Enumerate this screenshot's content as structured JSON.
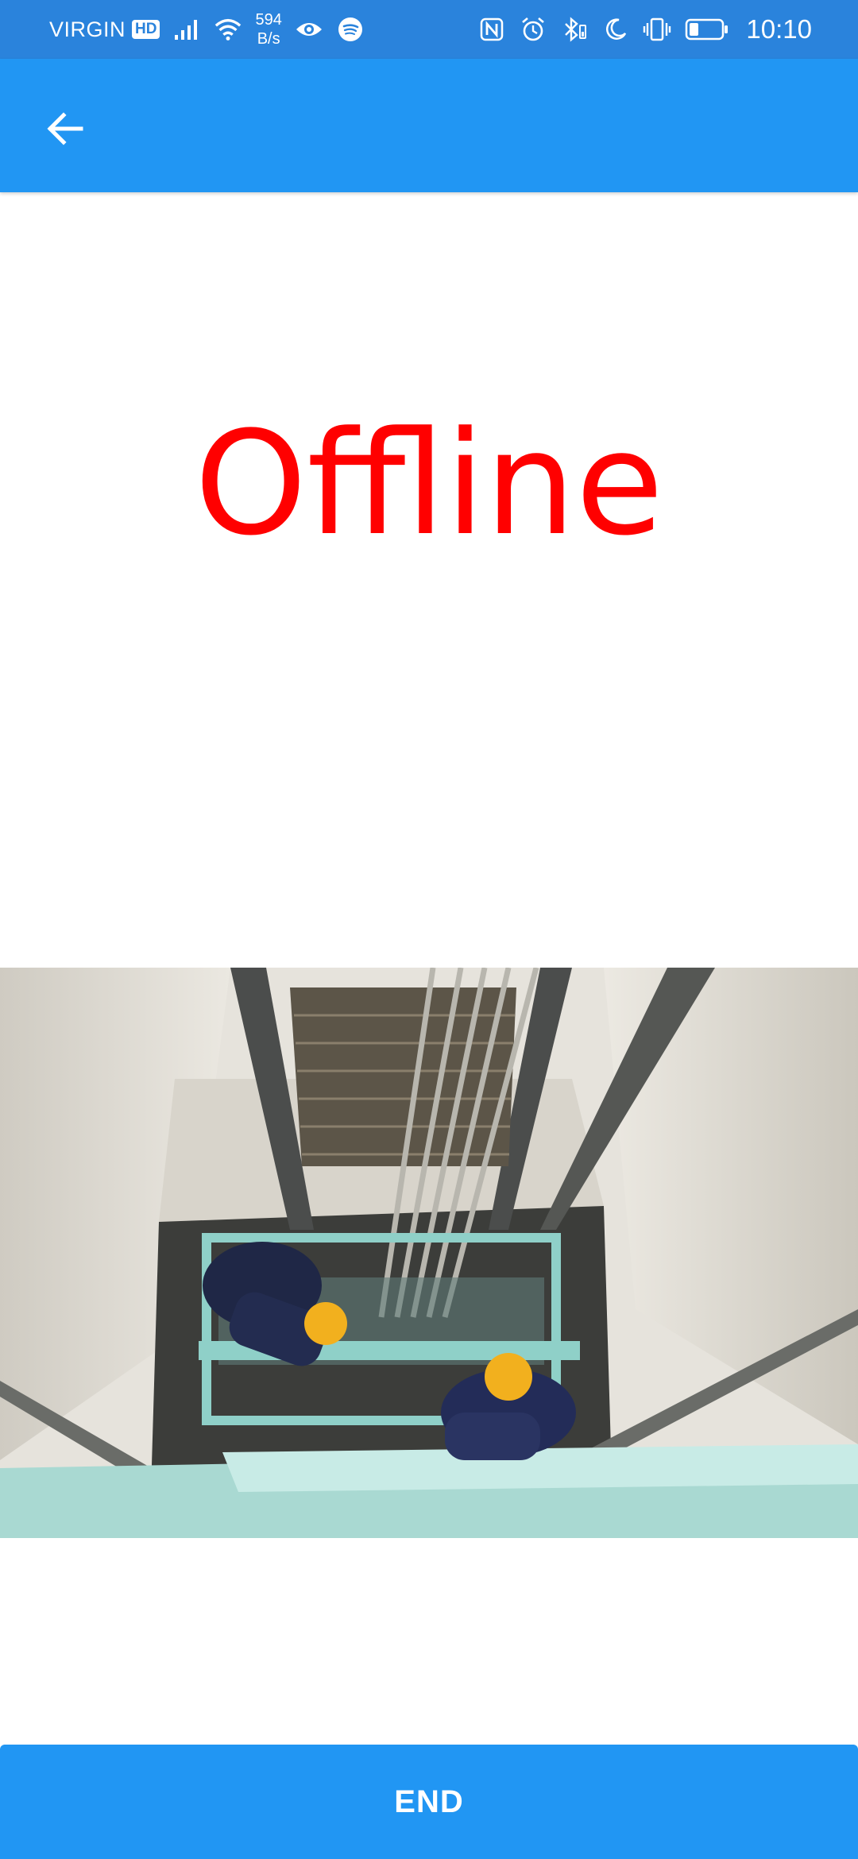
{
  "status_bar": {
    "carrier": "VIRGIN",
    "hd_badge": "HD",
    "net_speed_value": "594",
    "net_speed_unit": "B/s",
    "time": "10:10",
    "icons": [
      "signal-icon",
      "wifi-icon",
      "eye-icon",
      "spotify-icon",
      "nfc-icon",
      "alarm-icon",
      "bluetooth-icon",
      "moon-icon",
      "vibrate-icon",
      "battery-icon"
    ],
    "battery_level": 0.25
  },
  "app_bar": {
    "back_icon": "arrow-back-icon",
    "color": "#2196f3"
  },
  "main": {
    "status_text": "Offline",
    "status_color": "#ff0000",
    "image_subject": "elevator-shaft-workers-photo"
  },
  "footer": {
    "end_label": "END",
    "color": "#2196f3"
  }
}
